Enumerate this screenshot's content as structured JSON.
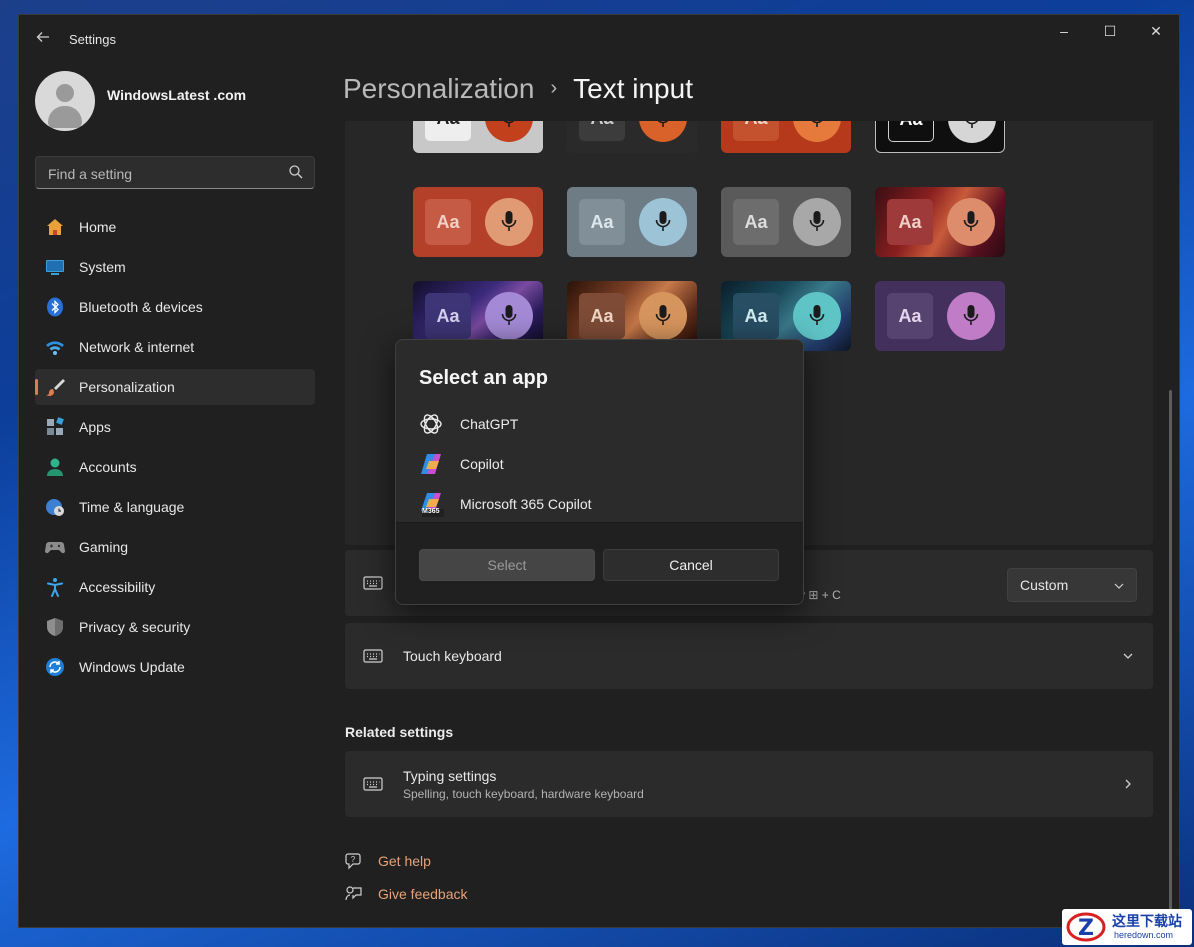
{
  "window": {
    "title": "Settings",
    "controls": {
      "minimize": "–",
      "maximize": "☐",
      "close": "✕"
    }
  },
  "user": {
    "name": "WindowsLatest .com"
  },
  "search": {
    "placeholder": "Find a setting"
  },
  "sidebar": {
    "items": [
      {
        "label": "Home",
        "icon": "home-icon",
        "active": false
      },
      {
        "label": "System",
        "icon": "system-icon",
        "active": false
      },
      {
        "label": "Bluetooth & devices",
        "icon": "bluetooth-icon",
        "active": false
      },
      {
        "label": "Network & internet",
        "icon": "wifi-icon",
        "active": false
      },
      {
        "label": "Personalization",
        "icon": "paintbrush-icon",
        "active": true
      },
      {
        "label": "Apps",
        "icon": "apps-icon",
        "active": false
      },
      {
        "label": "Accounts",
        "icon": "accounts-icon",
        "active": false
      },
      {
        "label": "Time & language",
        "icon": "globe-clock-icon",
        "active": false
      },
      {
        "label": "Gaming",
        "icon": "gamepad-icon",
        "active": false
      },
      {
        "label": "Accessibility",
        "icon": "accessibility-icon",
        "active": false
      },
      {
        "label": "Privacy & security",
        "icon": "shield-icon",
        "active": false
      },
      {
        "label": "Windows Update",
        "icon": "update-icon",
        "active": false
      }
    ]
  },
  "header": {
    "parent": "Personalization",
    "separator": "›",
    "current": "Text input"
  },
  "themes": {
    "tile_label": "Aa",
    "tiles": [
      {
        "bg": "#c8c8c8",
        "mic": "#c3401c",
        "aa_bg": "#eeeeee",
        "aa_color": "#1c1c1c"
      },
      {
        "bg": "#2a2a2a",
        "mic": "#d8622a",
        "aa_bg": "#3c3c3c",
        "aa_color": "#cfcfcf"
      },
      {
        "bg": "#b5391a",
        "mic": "#e67a3c",
        "aa_bg": "#c4522e",
        "aa_color": "#f0d6cc"
      },
      {
        "bg": "#0f0f0f",
        "mic": "#d6d6d6",
        "aa_bg": "#0f0f0f",
        "aa_color": "#ffffff",
        "outlined": true
      },
      {
        "bg": "#b4402a",
        "mic": "#e09a74",
        "aa_bg": "#c55a45",
        "aa_color": "#f2d0c5"
      },
      {
        "bg": "#6e7c86",
        "mic": "#9dc3d6",
        "aa_bg": "#818f99",
        "aa_color": "#dde6ec"
      },
      {
        "bg": "#5a5a5a",
        "mic": "#a8a8a8",
        "aa_bg": "#6d6d6d",
        "aa_color": "#dddddd"
      },
      {
        "bg": "#8a1f1f",
        "mic": "#dd8c6c",
        "aa_bg": "#9e3a3a",
        "aa_color": "#f0d0c8",
        "pattern": "red"
      },
      {
        "bg": "#2c2460",
        "mic": "#a48ad6",
        "aa_bg": "#3d3576",
        "aa_color": "#d8d0f0",
        "pattern": "purple"
      },
      {
        "bg": "#6a3a26",
        "mic": "#d7955e",
        "aa_bg": "#7e4c36",
        "aa_color": "#f0d8c6",
        "pattern": "copper"
      },
      {
        "bg": "#163c52",
        "mic": "#5fc4c6",
        "aa_bg": "#284e64",
        "aa_color": "#d0ecee",
        "pattern": "teal"
      },
      {
        "bg": "#43305c",
        "mic": "#c07cc6",
        "aa_bg": "#564370",
        "aa_color": "#e6d4ec"
      },
      {
        "bg": "#1e9a7a",
        "mic": "#4fc7b0",
        "aa_bg": "#2aa88a",
        "aa_color": "#e0f6f0"
      }
    ]
  },
  "voice_typing": {
    "dropdown_value": "Custom",
    "hint_fragment": "y ⊞ + C"
  },
  "touch_keyboard": {
    "label": "Touch keyboard"
  },
  "related": {
    "heading": "Related settings",
    "typing": {
      "title": "Typing settings",
      "subtitle": "Spelling, touch keyboard, hardware keyboard"
    }
  },
  "links": {
    "help": "Get help",
    "feedback": "Give feedback"
  },
  "dialog": {
    "title": "Select an app",
    "apps": [
      {
        "name": "ChatGPT",
        "icon": "chatgpt-icon"
      },
      {
        "name": "Copilot",
        "icon": "copilot-icon"
      },
      {
        "name": "Microsoft 365 Copilot",
        "icon": "m365-copilot-icon",
        "badge": "M365"
      }
    ],
    "select_label": "Select",
    "cancel_label": "Cancel"
  },
  "watermark": {
    "text": "这里下载站",
    "url": "heredown.com"
  },
  "colors": {
    "accent": "#e07b50",
    "link": "#e7a278",
    "window_bg": "#202020",
    "card_bg": "#2b2b2b"
  }
}
